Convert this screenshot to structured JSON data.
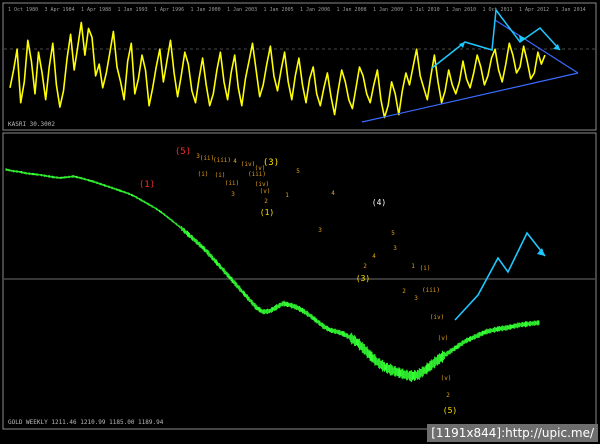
{
  "upper_panel": {
    "corner_label": "KASRI 30.3002",
    "date_labels": [
      "1 Oct 1980",
      "3 Apr 1984",
      "1 Apr 1988",
      "1 Jan 1993",
      "1 Apr 1996",
      "1 Jan 2000",
      "1 Jan 2003",
      "1 Jan 2005",
      "1 Jan 2006",
      "1 Jan 2008",
      "1 Jan 2009",
      "1 Jul 2010",
      "1 Jan 2010",
      "1 Oct 2011",
      "1 Apr 2012",
      "1 Jan 2014"
    ]
  },
  "lower_panel": {
    "corner_label": "GOLD WEEKLY  1211.46  1210.99  1185.00  1189.94"
  },
  "watermark": "[1191x844]:http://upic.me/",
  "colors": {
    "background": "#000000",
    "oscillator": "#ffff00",
    "trendline": "#3a6bff",
    "projection": "#1ec8ff",
    "price": "#33ff33",
    "wave_major_red": "#ff2a2a",
    "wave_major_yellow": "#ffe000",
    "wave_minor": "#e3a020",
    "grid": "#4a4a4a",
    "level": "#6e6e6e"
  },
  "chart_data": [
    {
      "type": "line",
      "panel": "oscillator",
      "series": [
        {
          "values": [
            48,
            60,
            74,
            38,
            52,
            80,
            66,
            44,
            72,
            58,
            40,
            62,
            78,
            50,
            35,
            46,
            68,
            84,
            60,
            76,
            92,
            70,
            88,
            82,
            56,
            64,
            48,
            58,
            72,
            86,
            62,
            52,
            40,
            66,
            78,
            44,
            54,
            70,
            60,
            36,
            48,
            62,
            74,
            52,
            66,
            80,
            58,
            42,
            56,
            72,
            64,
            46,
            38,
            54,
            68,
            50,
            36,
            44,
            60,
            72,
            52,
            40,
            58,
            70,
            48,
            36,
            54,
            66,
            78,
            60,
            42,
            50,
            64,
            76,
            56,
            46,
            60,
            72,
            52,
            40,
            56,
            68,
            50,
            38,
            54,
            62,
            44,
            36,
            48,
            58,
            42,
            30,
            46,
            60,
            52,
            40,
            34,
            48,
            62,
            56,
            44,
            38,
            50,
            60,
            40,
            28,
            36,
            52,
            44,
            30,
            46,
            58,
            50,
            62,
            74,
            56,
            48,
            40,
            56,
            70,
            52,
            38,
            46,
            60,
            50,
            44,
            52,
            66,
            54,
            48,
            58,
            70,
            62,
            50,
            56,
            68,
            74,
            60,
            52,
            64,
            78,
            70,
            58,
            62,
            76,
            66,
            54,
            58,
            72,
            64,
            70
          ]
        }
      ]
    },
    {
      "type": "line",
      "panel": "price",
      "series": [
        {
          "values": [
            1200,
            1196,
            1194,
            1190,
            1188,
            1186,
            1183,
            1180,
            1178,
            1180,
            1182,
            1178,
            1173,
            1168,
            1162,
            1156,
            1150,
            1144,
            1138,
            1130,
            1120,
            1110,
            1100,
            1088,
            1074,
            1060,
            1046,
            1030,
            1014,
            998,
            980,
            960,
            940,
            920,
            900,
            880,
            860,
            840,
            828,
            830,
            840,
            850,
            846,
            840,
            830,
            818,
            804,
            790,
            780,
            776,
            770,
            760,
            748,
            730,
            712,
            696,
            684,
            676,
            670,
            664,
            660,
            664,
            676,
            690,
            704,
            716,
            728,
            740,
            752,
            760,
            768,
            776,
            780,
            784,
            786,
            790,
            794,
            796,
            798,
            800
          ]
        }
      ]
    }
  ]
}
